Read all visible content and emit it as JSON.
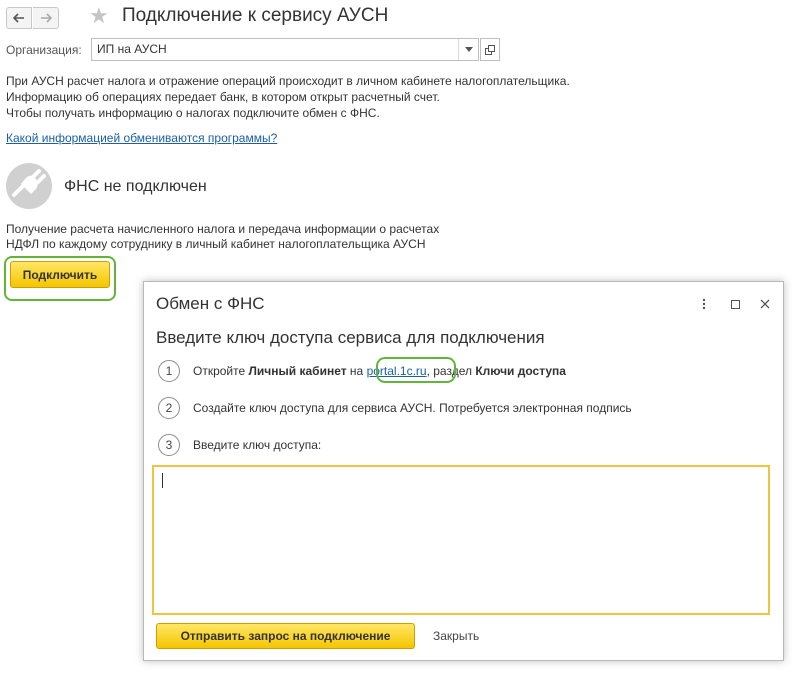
{
  "header": {
    "title": "Подключение к сервису АУСН"
  },
  "organization": {
    "label": "Организация:",
    "value": "ИП на АУСН"
  },
  "info_lines": [
    "При АУСН расчет налога и отражение операций происходит в личном кабинете налогоплательщика.",
    "Информацию об операциях передает банк, в котором открыт расчетный счет.",
    "Чтобы получать информацию о налогах подключите обмен с ФНС."
  ],
  "exchange_link": "Какой информацией обмениваются программы?",
  "fns": {
    "status": "ФНС не подключен",
    "description_lines": [
      "Получение расчета начисленного налога и передача информации о расчетах",
      "НДФЛ по каждому сотруднику в личный кабинет налогоплательщика АУСН"
    ],
    "connect_label": "Подключить"
  },
  "dialog": {
    "title": "Обмен с ФНС",
    "heading": "Введите ключ доступа сервиса для подключения",
    "steps": [
      {
        "number": "1",
        "prefix": "Откройте ",
        "bold1": "Личный кабинет",
        "middle": " на ",
        "link": "portal.1c.ru",
        "after_link": ", раздел ",
        "bold2": "Ключи доступа"
      },
      {
        "number": "2",
        "text": "Создайте ключ доступа для сервиса АУСН. Потребуется электронная подпись"
      },
      {
        "number": "3",
        "text": "Введите ключ доступа:"
      }
    ],
    "key_value": "",
    "send_label": "Отправить запрос на подключение",
    "close_label": "Закрыть"
  },
  "colors": {
    "accent_yellow": "#f5c500",
    "highlight_green": "#62b53b",
    "link_blue": "#1a5fa8",
    "input_focus_border": "#f0c340"
  }
}
